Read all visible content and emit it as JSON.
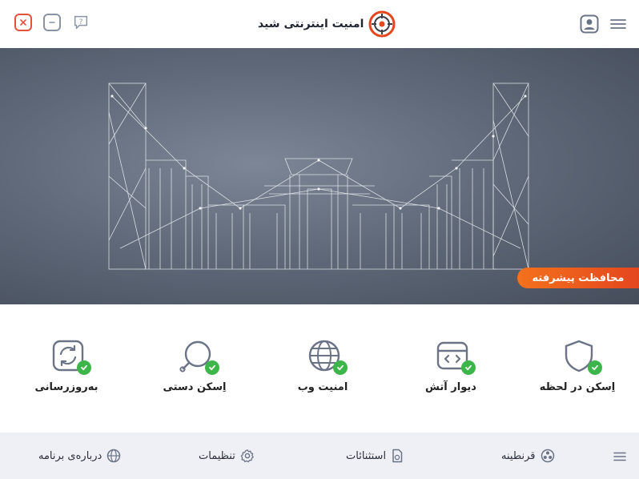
{
  "window": {
    "title": "امنیت اینترنتی شید"
  },
  "banner": {
    "badge": "محافظت پیشرفته"
  },
  "features": [
    {
      "label": "اِسکن در لحظه",
      "icon": "shield-icon"
    },
    {
      "label": "دیوار آتش",
      "icon": "firewall-icon"
    },
    {
      "label": "امنیت وب",
      "icon": "globe-icon"
    },
    {
      "label": "اِسکن دستی",
      "icon": "magnifier-icon"
    },
    {
      "label": "به‌روزرسانی",
      "icon": "update-icon"
    }
  ],
  "bottom_nav": [
    {
      "label": "قرنطینه",
      "icon": "biohazard-icon"
    },
    {
      "label": "استثنائات",
      "icon": "file-exception-icon"
    },
    {
      "label": "تنظیمات",
      "icon": "gear-icon"
    },
    {
      "label": "درباره‌ی برنامه",
      "icon": "globe-icon"
    }
  ],
  "colors": {
    "accent": "#e4461e",
    "success": "#3cb64a",
    "icon": "#6b7386"
  }
}
